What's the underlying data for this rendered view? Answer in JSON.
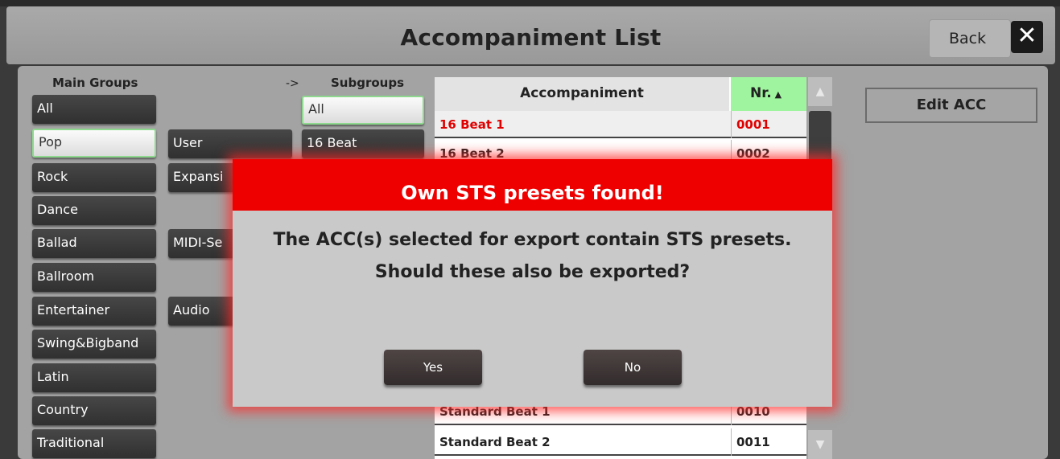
{
  "header": {
    "title": "Accompaniment List",
    "back_label": "Back",
    "close_glyph": "✕"
  },
  "labels": {
    "main_groups": "Main Groups",
    "arrow": "->",
    "subgroups": "Subgroups"
  },
  "main_groups": [
    "All",
    "Pop",
    "Rock",
    "Dance",
    "Ballad",
    "Ballroom",
    "Entertainer",
    "Swing&Bigband",
    "Latin",
    "Country",
    "Traditional"
  ],
  "main_selected": "Pop",
  "sources": [
    "User",
    "Expansi",
    "MIDI-Se",
    "Audio"
  ],
  "subgroups": [
    "All",
    "16 Beat"
  ],
  "subgroup_selected": "All",
  "table": {
    "col_accompaniment": "Accompaniment",
    "col_nr": "Nr.",
    "sort_glyph": "▲",
    "rows": [
      {
        "name": "16 Beat 1",
        "nr": "0001",
        "active": true
      },
      {
        "name": "16 Beat 2",
        "nr": "0002"
      },
      {
        "name": "Standard Beat 1",
        "nr": "0010"
      },
      {
        "name": "Standard Beat 2",
        "nr": "0011"
      }
    ]
  },
  "scrollbar": {
    "up_glyph": "▲",
    "down_glyph": "▼"
  },
  "edit_button": "Edit ACC",
  "dialog": {
    "title": "Own STS presets found!",
    "line1": "The ACC(s) selected for export contain STS presets.",
    "line2": "Should these also be exported?",
    "yes": "Yes",
    "no": "No"
  },
  "colors": {
    "dialog_header": "#ef0000",
    "active_row_text": "#e00000",
    "sort_column": "#9ff49f"
  }
}
